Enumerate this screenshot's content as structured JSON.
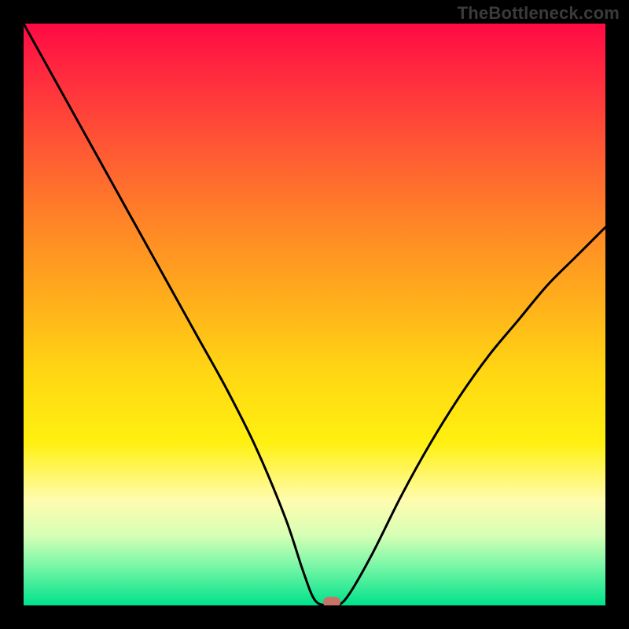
{
  "watermark": "TheBottleneck.com",
  "chart_data": {
    "type": "line",
    "title": "",
    "xlabel": "",
    "ylabel": "",
    "xlim": [
      0,
      100
    ],
    "ylim": [
      0,
      100
    ],
    "grid": false,
    "legend": false,
    "background": "vertical-gradient red→orange→yellow→green",
    "series": [
      {
        "name": "bottleneck-curve",
        "x": [
          0,
          5,
          10,
          15,
          20,
          25,
          30,
          35,
          40,
          45,
          48,
          50,
          52,
          54,
          56,
          60,
          65,
          70,
          75,
          80,
          85,
          90,
          95,
          100
        ],
        "y": [
          100,
          91,
          82,
          73,
          64,
          55,
          46,
          37,
          27,
          15,
          6,
          1,
          0,
          0,
          2,
          9,
          19,
          28,
          36,
          43,
          49,
          55,
          60,
          65
        ]
      }
    ],
    "marker": {
      "x": 53,
      "y": 0.5,
      "shape": "rounded-rect",
      "color": "#c77367"
    }
  },
  "colors": {
    "frame": "#000000",
    "watermark": "#3b3b3b",
    "curve": "#000000",
    "marker": "#c77367",
    "gradient_stops": [
      "#ff0a45",
      "#ff5a33",
      "#ffb01b",
      "#fff010",
      "#fffcb0",
      "#00e28b"
    ]
  }
}
